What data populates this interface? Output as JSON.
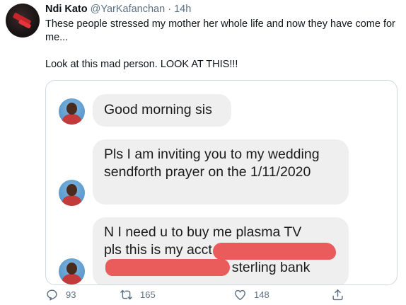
{
  "tweet": {
    "author_name": "Ndi Kato",
    "handle": "@YarKafanchan",
    "separator": "·",
    "time": "14h",
    "text_line1": "These people stressed my mother her whole life and now they have come for me...",
    "text_line2": "Look at this mad person. LOOK AT THIS!!!"
  },
  "screenshot": {
    "messages": [
      {
        "text": "Good morning sis"
      },
      {
        "text": "Pls I am inviting you to my wedding sendforth prayer on the 1/11/2020"
      },
      {
        "text_line1": "N I need u to buy me plasma TV",
        "text_line2": "pls this is my acct no",
        "text_line3": "er sterling bank"
      }
    ],
    "redaction_color": "#ea5b5b"
  },
  "actions": {
    "reply_count": "93",
    "retweet_count": "165",
    "like_count": "148",
    "icons": [
      "reply-icon",
      "retweet-icon",
      "like-icon",
      "share-icon"
    ]
  },
  "colors": {
    "text": "#0f1419",
    "secondary": "#5b7083",
    "bubble": "#efefef"
  }
}
